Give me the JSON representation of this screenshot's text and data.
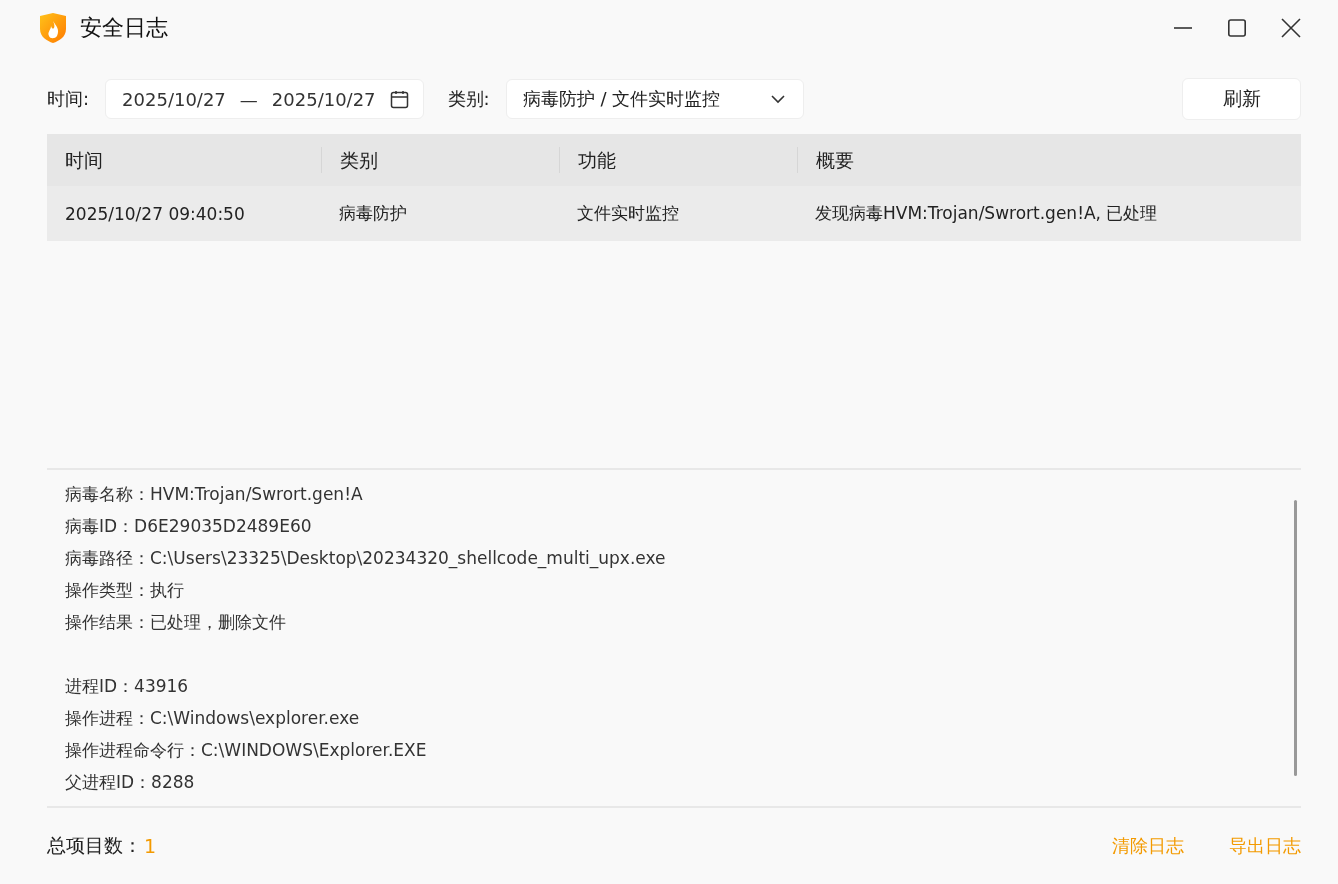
{
  "window": {
    "title": "安全日志"
  },
  "filters": {
    "time_label": "时间:",
    "date_from": "2025/10/27",
    "date_separator": "—",
    "date_to": "2025/10/27",
    "category_label": "类别:",
    "category_value": "病毒防护 / 文件实时监控",
    "refresh_button": "刷新"
  },
  "table": {
    "columns": [
      "时间",
      "类别",
      "功能",
      "概要"
    ],
    "rows": [
      {
        "selected": true,
        "cells": [
          "2025/10/27 09:40:50",
          "病毒防护",
          "文件实时监控",
          "发现病毒HVM:Trojan/Swrort.gen!A, 已处理"
        ]
      }
    ]
  },
  "details": {
    "groups": [
      [
        "病毒名称：HVM:Trojan/Swrort.gen!A",
        "病毒ID：D6E29035D2489E60",
        "病毒路径：C:\\Users\\23325\\Desktop\\20234320_shellcode_multi_upx.exe",
        "操作类型：执行",
        "操作结果：已处理，删除文件"
      ],
      [
        "进程ID：43916",
        "操作进程：C:\\Windows\\explorer.exe",
        "操作进程命令行：C:\\WINDOWS\\Explorer.EXE",
        "父进程ID：8288"
      ]
    ]
  },
  "status_bar": {
    "total_label": "总项目数：",
    "total_value": "1",
    "actions": [
      "清除日志",
      "导出日志"
    ]
  }
}
